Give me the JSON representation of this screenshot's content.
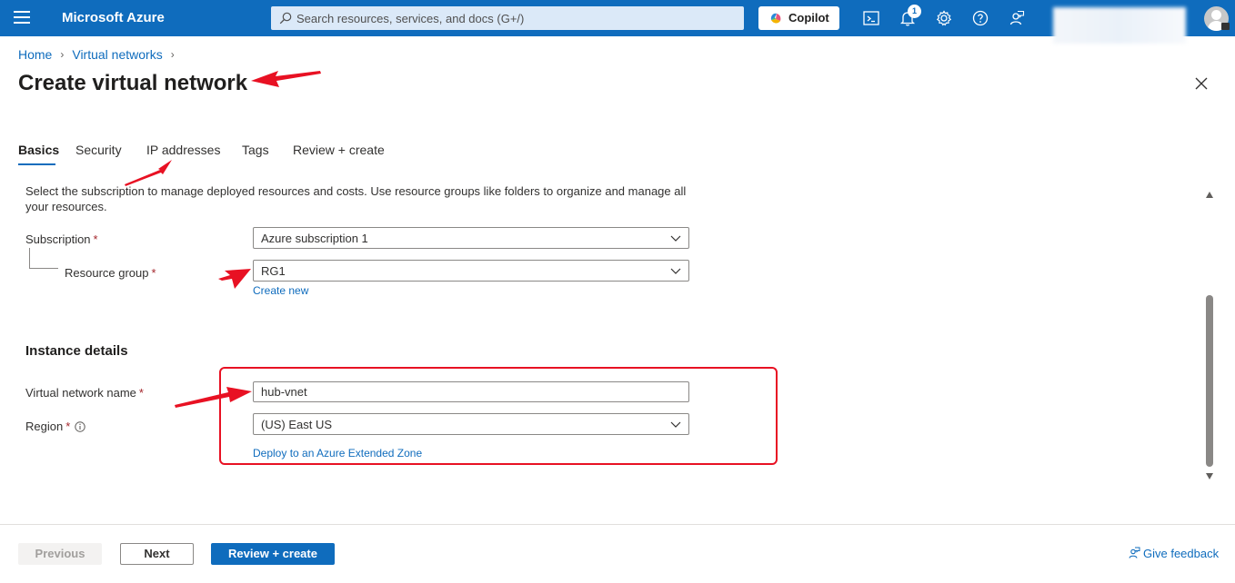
{
  "topbar": {
    "brand": "Microsoft Azure",
    "search_placeholder": "Search resources, services, and docs (G+/)",
    "copilot_label": "Copilot",
    "notification_count": "1"
  },
  "breadcrumb": {
    "items": [
      "Home",
      "Virtual networks"
    ]
  },
  "page": {
    "title": "Create virtual network"
  },
  "tabs": [
    {
      "label": "Basics",
      "active": true
    },
    {
      "label": "Security",
      "active": false
    },
    {
      "label": "IP addresses",
      "active": false
    },
    {
      "label": "Tags",
      "active": false
    },
    {
      "label": "Review + create",
      "active": false
    }
  ],
  "form": {
    "description": "Select the subscription to manage deployed resources and costs. Use resource groups like folders to organize and manage all your resources.",
    "subscription": {
      "label": "Subscription",
      "value": "Azure subscription 1"
    },
    "resource_group": {
      "label": "Resource group",
      "value": "RG1",
      "create_new_link": "Create new"
    },
    "instance_details_title": "Instance details",
    "vnet_name": {
      "label": "Virtual network name",
      "value": "hub-vnet"
    },
    "region": {
      "label": "Region",
      "value": "(US) East US",
      "extended_zone_link": "Deploy to an Azure Extended Zone"
    },
    "required_marker": "*"
  },
  "footer": {
    "previous_label": "Previous",
    "next_label": "Next",
    "review_create_label": "Review + create",
    "feedback_label": "Give feedback"
  },
  "colors": {
    "azure_blue": "#0f6cbd",
    "annotation_red": "#e81123",
    "required_red": "#a4262c"
  },
  "icons": [
    "hamburger-icon",
    "search-icon",
    "copilot-icon",
    "cloud-shell-icon",
    "bell-icon",
    "gear-icon",
    "help-icon",
    "feedback-person-icon",
    "close-icon",
    "chevron-down-icon",
    "info-icon"
  ]
}
